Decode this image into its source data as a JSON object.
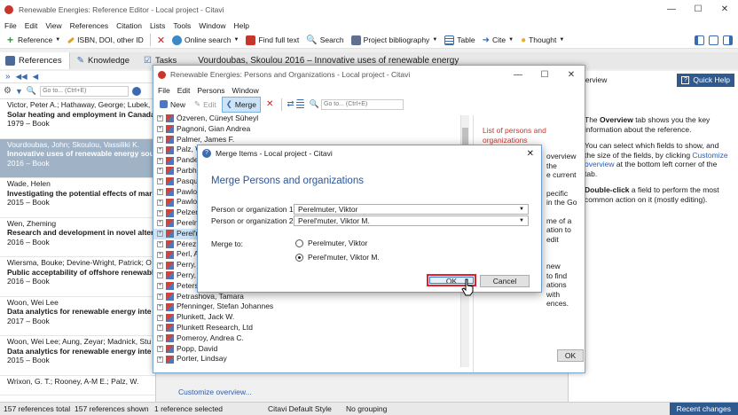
{
  "app": {
    "title": "Renewable Energies: Reference Editor - Local project - Citavi"
  },
  "menu": [
    "File",
    "Edit",
    "View",
    "References",
    "Citation",
    "Lists",
    "Tools",
    "Window",
    "Help"
  ],
  "toolbar": {
    "reference": "Reference",
    "isbn": "ISBN, DOI, other ID",
    "online_search": "Online search",
    "full_text": "Find full text",
    "search": "Search",
    "bibliography": "Project bibliography",
    "table": "Table",
    "cite": "Cite",
    "thought": "Thought"
  },
  "tabs": {
    "references": "References",
    "knowledge": "Knowledge",
    "tasks": "Tasks"
  },
  "header_title": "Vourdoubas, Skoulou 2016 – Innovative uses of renewable energy",
  "search": {
    "placeholder": "Go to... (Ctrl+E)"
  },
  "references": [
    {
      "authors": "Victor, Peter A.; Hathaway, George; Lubek,",
      "title": "Solar heating and employment in Canada",
      "meta": "1979 – Book"
    },
    {
      "authors": "Vourdoubas, John; Skoulou, Vassiliki K.",
      "title": "Innovative uses of renewable energy sou",
      "meta": "2016 – Book"
    },
    {
      "authors": "Wade, Helen",
      "title": "Investigating the potential effects of mar",
      "meta": "2015 – Book"
    },
    {
      "authors": "Wen, Zheming",
      "title": "Research and development in novel alter",
      "meta": "2016 – Book"
    },
    {
      "authors": "Wiersma, Bouke; Devine-Wright, Patrick; O",
      "title": "Public acceptability of offshore renewabl",
      "meta": "2016 – Book"
    },
    {
      "authors": "Woon, Wei Lee",
      "title": "Data analytics for renewable energy inte",
      "meta": "2017 – Book"
    },
    {
      "authors": "Woon, Wei Lee; Aung, Zeyar; Madnick, Stu",
      "title": "Data analytics for renewable energy inte",
      "meta": "2015 – Book"
    },
    {
      "authors": "Wrixon, G. T.; Rooney, A-M E.; Palz, W.",
      "title": "",
      "meta": ""
    }
  ],
  "right_panel": {
    "header": "Overview",
    "quick_help": "Quick Help",
    "p1a": "The ",
    "p1b": "Overview",
    "p1c": " tab shows you the key information about the reference.",
    "p2a": "You can select which fields to show, and the size of the fields, by clicking ",
    "p2b": "Customize overview",
    "p2c": " at the bottom left corner of the tab.",
    "p3a": "Double-click",
    "p3b": " a field to perform the most common action on it (mostly editing)."
  },
  "customize_link": "Customize overview...",
  "status": {
    "total": "157 references total",
    "shown": "157 references shown",
    "selected": "1 reference selected",
    "style": "Citavi Default Style",
    "grouping": "No grouping",
    "changes": "Recent changes"
  },
  "persons_window": {
    "title": "Renewable Energies: Persons and Organizations - Local project - Citavi",
    "menu": [
      "File",
      "Edit",
      "Persons",
      "Window"
    ],
    "new": "New",
    "edit": "Edit",
    "merge": "Merge",
    "goto_placeholder": "Go to... (Ctrl+E)",
    "names": [
      "Özveren, Cüneyt Süheyl",
      "Pagnoni, Gian Andrea",
      "Palmer, James F.",
      "Palz, W.",
      "Pandey",
      "Parbha",
      "Pasqua",
      "Pawlow",
      "Pawlow",
      "Pelzer",
      "Perelm",
      "Perel'm",
      "Pérez D",
      "Perl, A",
      "Perry, C",
      "Perry, S",
      "Peterse",
      "Petrashova, Tamara",
      "Pfenninger, Stefan Johannes",
      "Plunkett, Jack W.",
      "Plunkett Research, Ltd",
      "Pomeroy, Andrea C.",
      "Popp, David",
      "Porter, Lindsay"
    ],
    "right_link": "List of persons and organizations",
    "right_text": [
      "overview",
      "the",
      "e current",
      "pecific",
      "in the Go",
      "me of a",
      "ation to edit",
      "new",
      "to find",
      "ations with",
      "ences."
    ],
    "ok": "OK"
  },
  "merge_dialog": {
    "title": "Merge Items - Local project - Citavi",
    "heading": "Merge Persons and organizations",
    "label1": "Person or organization 1:",
    "value1": "Perelmuter, Viktor",
    "label2": "Person or organization 2:",
    "value2": "Perel'muter, Viktor M.",
    "merge_to": "Merge to:",
    "option1": "Perelmuter, Viktor",
    "option2": "Perel'muter, Viktor M.",
    "selected_option": 2,
    "ok": "OK",
    "cancel": "Cancel"
  }
}
